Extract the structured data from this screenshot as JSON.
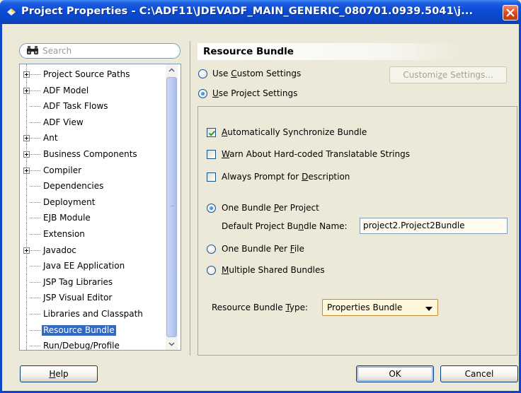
{
  "window": {
    "title": "Project Properties - C:\\ADF11\\JDEVADF_MAIN_GENERIC_080701.0939.5041\\j..."
  },
  "search": {
    "placeholder": "Search"
  },
  "tree": {
    "items": [
      {
        "label": "Project Source Paths",
        "expandable": true
      },
      {
        "label": "ADF Model",
        "expandable": true
      },
      {
        "label": "ADF Task Flows",
        "expandable": false
      },
      {
        "label": "ADF View",
        "expandable": false
      },
      {
        "label": "Ant",
        "expandable": true
      },
      {
        "label": "Business Components",
        "expandable": true
      },
      {
        "label": "Compiler",
        "expandable": true
      },
      {
        "label": "Dependencies",
        "expandable": false
      },
      {
        "label": "Deployment",
        "expandable": false
      },
      {
        "label": "EJB Module",
        "expandable": false
      },
      {
        "label": "Extension",
        "expandable": false
      },
      {
        "label": "Javadoc",
        "expandable": true
      },
      {
        "label": "Java EE Application",
        "expandable": false
      },
      {
        "label": "JSP Tag Libraries",
        "expandable": false
      },
      {
        "label": "JSP Visual Editor",
        "expandable": false
      },
      {
        "label": "Libraries and Classpath",
        "expandable": false
      },
      {
        "label": "Resource Bundle",
        "expandable": false,
        "selected": true
      },
      {
        "label": "Run/Debug/Profile",
        "expandable": false
      }
    ]
  },
  "panel": {
    "title": "Resource Bundle",
    "use_custom_settings": {
      "pre": "Use ",
      "key": "C",
      "post": "ustom Settings",
      "checked": false
    },
    "use_project_settings": {
      "pre": "",
      "key": "U",
      "post": "se Project Settings",
      "checked": true
    },
    "customize_button": {
      "pre": "Customi",
      "key": "z",
      "post": "e Settings..."
    },
    "auto_sync": {
      "pre": "",
      "key": "A",
      "post": "utomatically Synchronize Bundle",
      "checked": true
    },
    "warn_hardcoded": {
      "pre": "",
      "key": "W",
      "post": "arn About Hard-coded Translatable Strings",
      "checked": false
    },
    "always_prompt": {
      "pre": "Always Prompt for ",
      "key": "D",
      "post": "escription",
      "checked": false
    },
    "one_per_project": {
      "pre": "One Bundle ",
      "key": "P",
      "post": "er Project",
      "checked": true
    },
    "default_bundle_label": {
      "pre": "Default Project Bu",
      "key": "n",
      "post": "dle Name:"
    },
    "default_bundle_value": "project2.Project2Bundle",
    "one_per_file": {
      "pre": "One Bundle Per ",
      "key": "F",
      "post": "ile",
      "checked": false
    },
    "multiple_shared": {
      "pre": "",
      "key": "M",
      "post": "ultiple Shared Bundles",
      "checked": false
    },
    "bundle_type_label": {
      "pre": "Resource Bundle ",
      "key": "T",
      "post": "ype:"
    },
    "bundle_type_value": "Properties Bundle"
  },
  "footer": {
    "help": {
      "pre": "",
      "key": "H",
      "post": "elp"
    },
    "ok": "OK",
    "cancel": "Cancel"
  }
}
